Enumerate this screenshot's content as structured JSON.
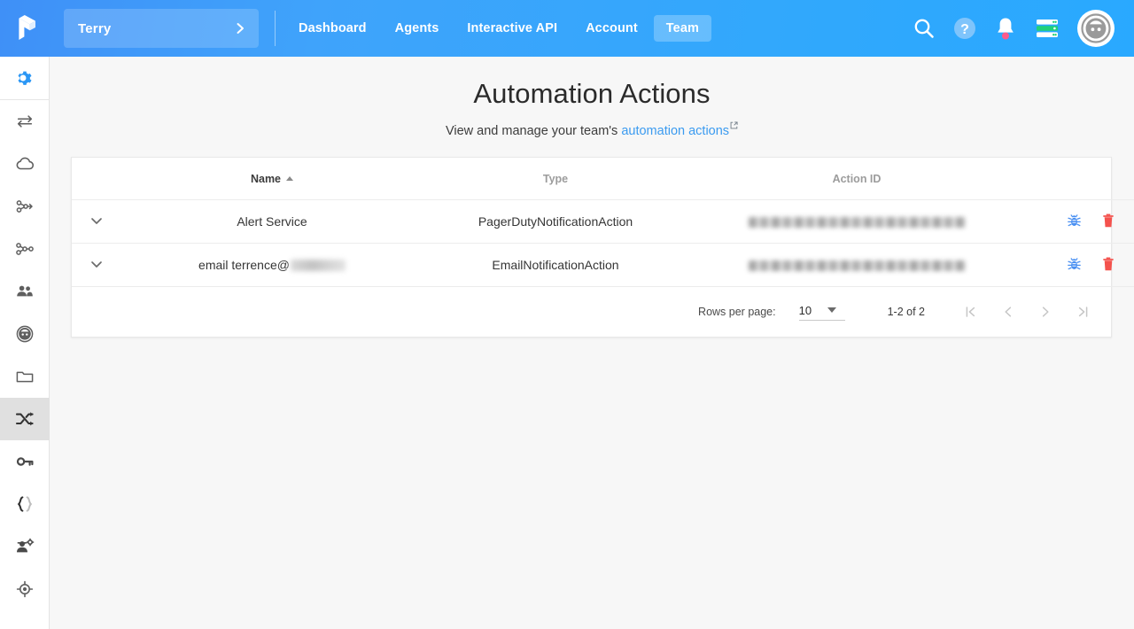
{
  "topbar": {
    "logo": "pipefy-logo-icon",
    "team_selector": {
      "name": "Terry",
      "chevron": "chevron-right-icon"
    },
    "nav": [
      {
        "label": "Dashboard",
        "active": false
      },
      {
        "label": "Agents",
        "active": false
      },
      {
        "label": "Interactive API",
        "active": false
      },
      {
        "label": "Account",
        "active": false
      },
      {
        "label": "Team",
        "active": true
      }
    ],
    "right_icons": [
      "search-icon",
      "help-icon",
      "notifications-bell-icon",
      "system-status-icon",
      "user-avatar-icon"
    ]
  },
  "sidebar": {
    "items": [
      {
        "name": "settings",
        "icon": "gear-icon",
        "selected": false
      },
      {
        "name": "transfers",
        "icon": "transfer-arrows-icon",
        "selected": false
      },
      {
        "name": "cloud",
        "icon": "cloud-icon",
        "selected": false
      },
      {
        "name": "add-workflow",
        "icon": "workflow-add-icon",
        "selected": false
      },
      {
        "name": "workflow",
        "icon": "workflow-icon",
        "selected": false
      },
      {
        "name": "users",
        "icon": "people-icon",
        "selected": false
      },
      {
        "name": "profile",
        "icon": "person-circle-icon",
        "selected": false
      },
      {
        "name": "files",
        "icon": "folder-icon",
        "selected": false
      },
      {
        "name": "automation-actions",
        "icon": "shuffle-arrows-icon",
        "selected": true
      },
      {
        "name": "credentials",
        "icon": "key-icon",
        "selected": false
      },
      {
        "name": "code",
        "icon": "braces-icon",
        "selected": false
      },
      {
        "name": "admin",
        "icon": "person-gear-icon",
        "selected": false
      },
      {
        "name": "target",
        "icon": "target-icon",
        "selected": false
      }
    ]
  },
  "page": {
    "title": "Automation Actions",
    "subtitle_prefix": "View and manage your team's ",
    "subtitle_link": "automation actions",
    "external_link_icon": "external-link-icon"
  },
  "table": {
    "columns": [
      {
        "key": "expand",
        "label": "",
        "sorted": false
      },
      {
        "key": "name",
        "label": "Name",
        "sorted": true,
        "sort_dir": "asc"
      },
      {
        "key": "type",
        "label": "Type",
        "sorted": false
      },
      {
        "key": "action_id",
        "label": "Action ID",
        "sorted": false
      },
      {
        "key": "actions",
        "label": "",
        "sorted": false
      }
    ],
    "rows": [
      {
        "expand_icon": "chevron-down-icon",
        "name": "Alert Service",
        "name_redacted": "",
        "type": "PagerDutyNotificationAction",
        "action_id": "",
        "action_id_redacted": true,
        "test_icon": "bug-icon",
        "delete_icon": "trash-icon"
      },
      {
        "expand_icon": "chevron-down-icon",
        "name": "email terrence@",
        "name_redacted": "redacted-domain",
        "type": "EmailNotificationAction",
        "action_id": "",
        "action_id_redacted": true,
        "test_icon": "bug-icon",
        "delete_icon": "trash-icon"
      }
    ]
  },
  "pagination": {
    "rows_per_page_label": "Rows per page:",
    "rows_per_page_value": "10",
    "dropdown_icon": "caret-down-icon",
    "range_text": "1-2 of 2",
    "buttons": [
      {
        "name": "first-page",
        "icon": "first-page-icon",
        "enabled": false
      },
      {
        "name": "previous-page",
        "icon": "chevron-left-icon",
        "enabled": false
      },
      {
        "name": "next-page",
        "icon": "chevron-right-icon",
        "enabled": false
      },
      {
        "name": "last-page",
        "icon": "last-page-icon",
        "enabled": false
      }
    ]
  },
  "colors": {
    "header_blue": "#3fa3fb",
    "accent_link": "#3b9bf0",
    "selected_rail": "#e0e0e0",
    "bug_blue": "#4a90f2",
    "trash_red": "#f4524d",
    "status_green": "#21d07a",
    "bell_dot": "#ff5a8a",
    "page_bg": "#f7f7f7"
  }
}
